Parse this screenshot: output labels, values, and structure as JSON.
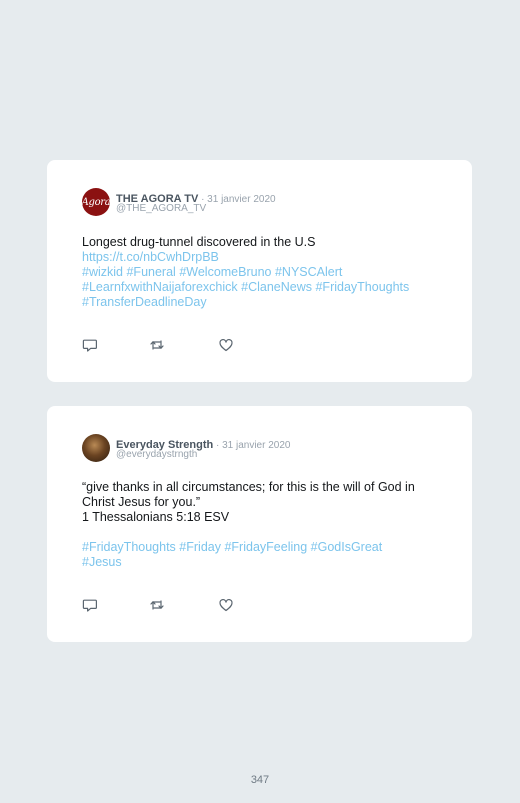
{
  "tweets": [
    {
      "author": "THE AGORA TV",
      "date": " · 31 janvier 2020",
      "handle": "@THE_AGORA_TV",
      "avatar_text": "Agora",
      "text_line1": "Longest drug-tunnel discovered in the U.S",
      "link": "https://t.co/nbCwhDrpBB",
      "hashtags_line1": [
        "#wizkid",
        "#Funeral",
        "#WelcomeBruno",
        "#NYSCAlert"
      ],
      "hashtags_line2": [
        "#LearnfxwithNaijaforexchick",
        "#ClaneNews",
        "#FridayThoughts"
      ],
      "hashtags_line3": [
        "#TransferDeadlineDay"
      ]
    },
    {
      "author": "Everyday Strength",
      "date": " · 31 janvier 2020",
      "handle": "@everydaystrngth",
      "text_line1": "“give thanks in all circumstances; for this is the will of God in",
      "text_line2": "Christ Jesus for you.”",
      "text_line3": "1 Thessalonians 5:18 ESV",
      "hashtags_line1": [
        "#FridayThoughts",
        "#Friday",
        "#FridayFeeling",
        "#GodIsGreat"
      ],
      "hashtags_line2": [
        "#Jesus"
      ]
    }
  ],
  "page_number": "347",
  "icons": [
    "reply-icon",
    "retweet-icon",
    "like-icon"
  ],
  "colors": {
    "link": "#7cc4ec",
    "background": "#e6ebee",
    "card": "#ffffff"
  }
}
